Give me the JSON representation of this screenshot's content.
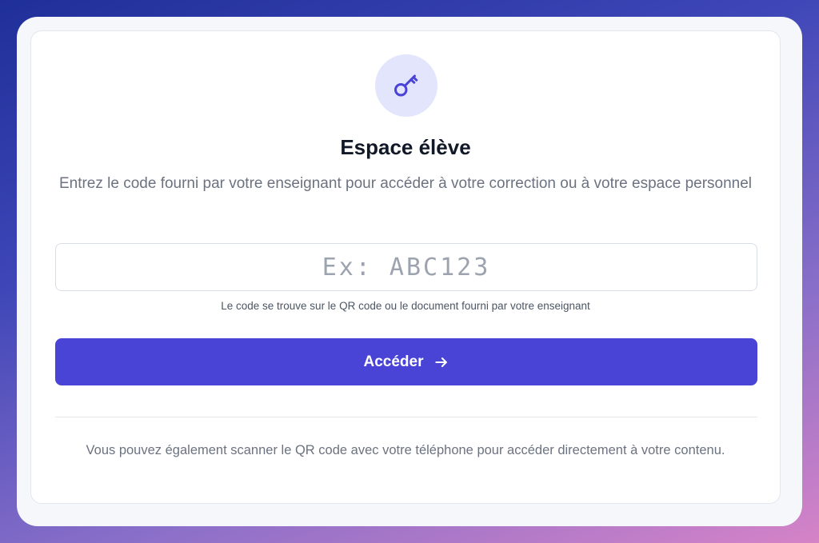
{
  "page": {
    "title": "Espace élève",
    "subtitle": "Entrez le code fourni par votre enseignant pour accéder à votre correction ou à votre espace personnel"
  },
  "form": {
    "code_placeholder": "Ex: ABC123",
    "code_value": "",
    "hint": "Le code se trouve sur le QR code ou le document fourni par votre enseignant",
    "submit_label": "Accéder"
  },
  "footer": {
    "note": "Vous pouvez également scanner le QR code avec votre téléphone pour accéder directement à votre contenu."
  },
  "icons": {
    "header": "key-icon",
    "submit": "arrow-right-icon"
  },
  "colors": {
    "accent": "#4a44d6",
    "icon_bg": "#e2e5fb",
    "title": "#111827",
    "muted": "#6b7280"
  }
}
